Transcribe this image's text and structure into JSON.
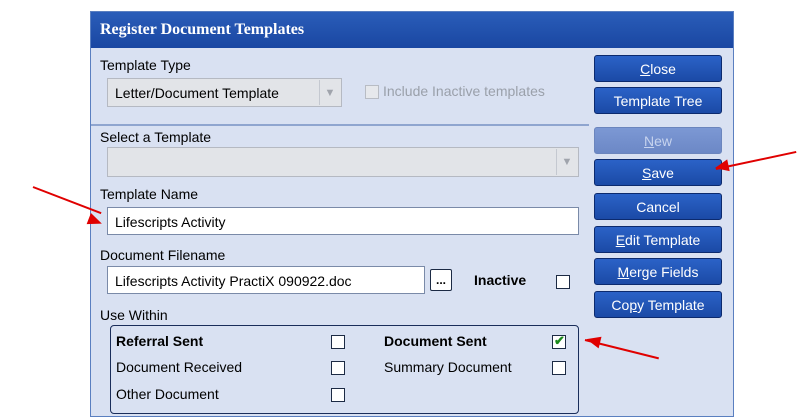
{
  "window": {
    "title": "Register Document Templates"
  },
  "template_type": {
    "label": "Template Type",
    "selected": "Letter/Document Template",
    "include_inactive_label": "Include Inactive templates"
  },
  "select_template": {
    "label": "Select a Template",
    "selected": ""
  },
  "template_name": {
    "label": "Template Name",
    "value": "Lifescripts Activity"
  },
  "document_filename": {
    "label": "Document Filename",
    "value": "Lifescripts Activity PractiX 090922.doc",
    "browse_label": "...",
    "inactive_label": "Inactive"
  },
  "use_within": {
    "label": "Use Within",
    "referral_sent": "Referral Sent",
    "document_sent": "Document Sent",
    "document_received": "Document Received",
    "summary_document": "Summary Document",
    "other_document": "Other Document"
  },
  "buttons": {
    "close": {
      "pre": "",
      "u": "C",
      "post": "lose"
    },
    "template_tree": "Template Tree",
    "new": {
      "pre": "",
      "u": "N",
      "post": "ew"
    },
    "save": {
      "pre": "",
      "u": "S",
      "post": "ave"
    },
    "cancel": "Cancel",
    "edit_template": {
      "pre": "",
      "u": "E",
      "post": "dit Template"
    },
    "merge_fields": {
      "pre": "",
      "u": "M",
      "post": "erge Fields"
    },
    "copy_template": {
      "pre": "Co",
      "u": "p",
      "post": "y Template"
    }
  },
  "colors": {
    "title_bar": "#1f4fae",
    "button": "#2357be",
    "window_bg": "#d9e1f2",
    "annotation_arrow": "#e00000"
  }
}
